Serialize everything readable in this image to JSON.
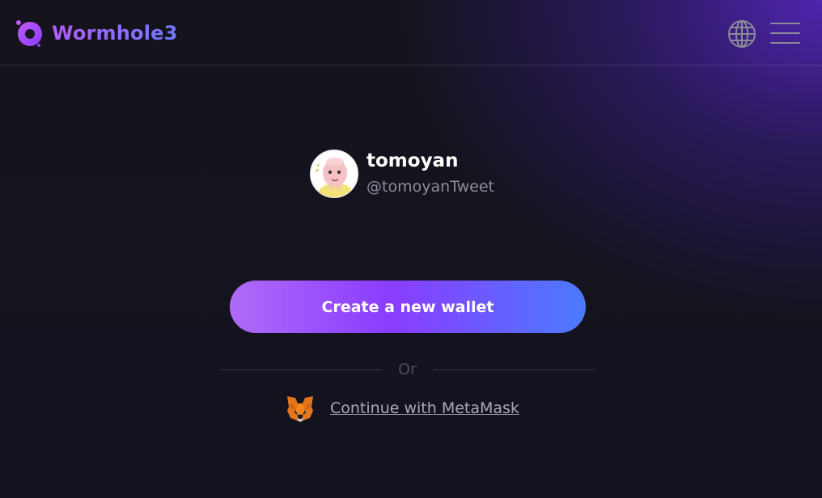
{
  "header": {
    "brand_name": "Wormhole3",
    "icons": [
      "wormhole-logo-icon",
      "globe-icon",
      "hamburger-menu-icon"
    ]
  },
  "profile": {
    "display_name": "tomoyan",
    "handle": "@tomoyanTweet"
  },
  "actions": {
    "create_wallet_label": "Create a new wallet",
    "divider_label": "Or",
    "metamask_label": "Continue with MetaMask"
  },
  "colors": {
    "brand_gradient_start": "#b25cf6",
    "brand_gradient_end": "#6f7bff",
    "button_gradient_start": "#b06af7",
    "button_gradient_end": "#4a7bff",
    "background": "#14131c",
    "accent_purple": "#5828c8"
  }
}
